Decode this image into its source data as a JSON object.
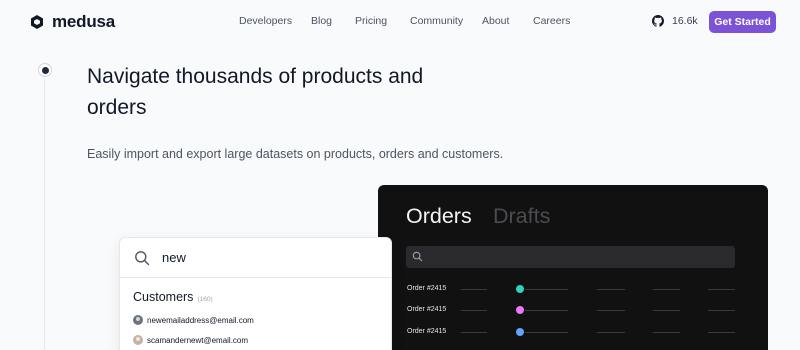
{
  "brand": {
    "name": "medusa",
    "logo_icon": "hexagon-logo-icon"
  },
  "nav": {
    "links": [
      "Developers",
      "Blog",
      "Pricing",
      "Community",
      "About",
      "Careers"
    ],
    "github_icon": "github-icon",
    "github_stars": "16.6k",
    "cta_label": "Get Started",
    "cta_color": "#7c53d6"
  },
  "hero": {
    "headline_line1": "Navigate thousands of products and",
    "headline_line2": "orders",
    "subtitle": "Easily import and export large datasets on products, orders and customers."
  },
  "search_card": {
    "query": "new",
    "search_icon": "search-icon",
    "section_title": "Customers",
    "section_count": "(160)",
    "results": [
      "newemailaddress@email.com",
      "scamandernewt@email.com"
    ]
  },
  "orders_panel": {
    "title": "Orders",
    "secondary_title": "Drafts",
    "search_icon": "search-icon",
    "rows": [
      {
        "label": "Order #2415",
        "status_color": "#2dd4bf"
      },
      {
        "label": "Order #2415",
        "status_color": "#e879f9"
      },
      {
        "label": "Order #2415",
        "status_color": "#60a5fa"
      }
    ]
  }
}
